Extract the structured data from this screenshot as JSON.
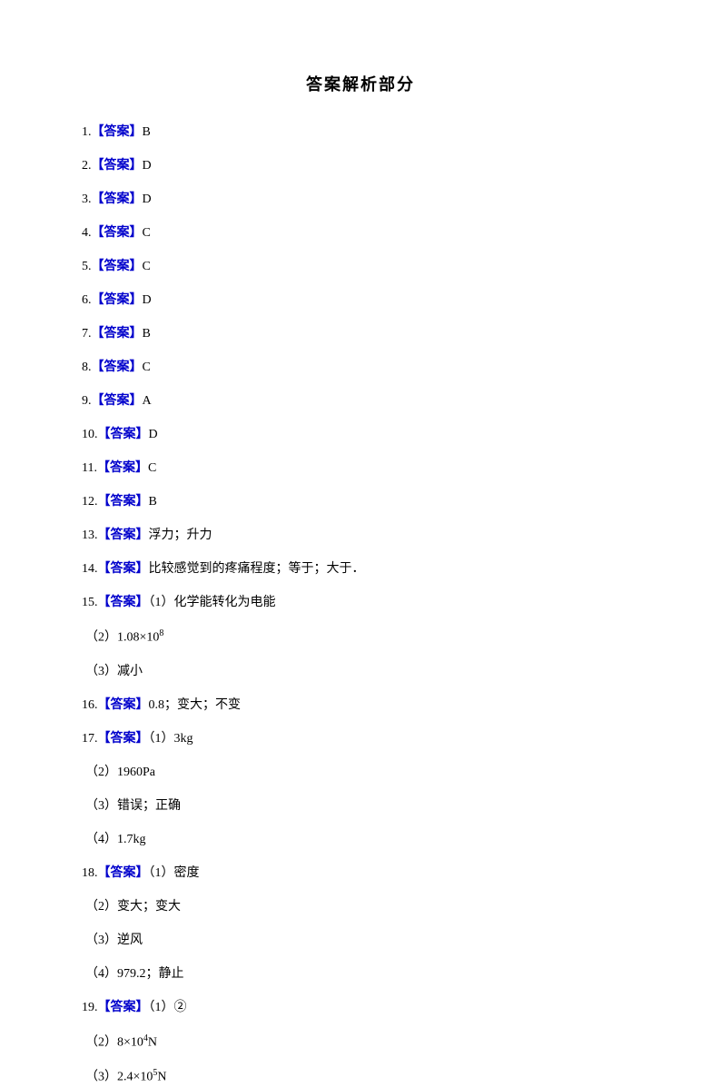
{
  "title": "答案解析部分",
  "answer_label": "【答案】",
  "items": [
    {
      "num": "1.",
      "val": "B"
    },
    {
      "num": "2.",
      "val": "D"
    },
    {
      "num": "3.",
      "val": "D"
    },
    {
      "num": "4.",
      "val": "C"
    },
    {
      "num": "5.",
      "val": "C"
    },
    {
      "num": "6.",
      "val": "D"
    },
    {
      "num": "7.",
      "val": "B"
    },
    {
      "num": "8.",
      "val": "C"
    },
    {
      "num": "9.",
      "val": "A"
    },
    {
      "num": "10.",
      "val": "D"
    },
    {
      "num": "11.",
      "val": "C"
    },
    {
      "num": "12.",
      "val": "B"
    },
    {
      "num": "13.",
      "val": "浮力；升力"
    },
    {
      "num": "14.",
      "val": "比较感觉到的疼痛程度；等于；大于．"
    },
    {
      "num": "15.",
      "val": "（1）化学能转化为电能",
      "subs": [
        "（2）1.08×10⁸",
        "（3）减小"
      ]
    },
    {
      "num": "16.",
      "val": "0.8；变大；不变"
    },
    {
      "num": "17.",
      "val": "（1）3kg",
      "subs": [
        "（2）1960Pa",
        "（3）错误；正确",
        "（4）1.7kg"
      ]
    },
    {
      "num": "18.",
      "val": "（1）密度",
      "subs": [
        "（2）变大；变大",
        "（3）逆风",
        "（4）979.2；静止"
      ]
    },
    {
      "num": "19.",
      "val": "（1）②",
      "subs": [
        "（2）8×10⁴N",
        "（3）2.4×10⁵N"
      ]
    }
  ]
}
